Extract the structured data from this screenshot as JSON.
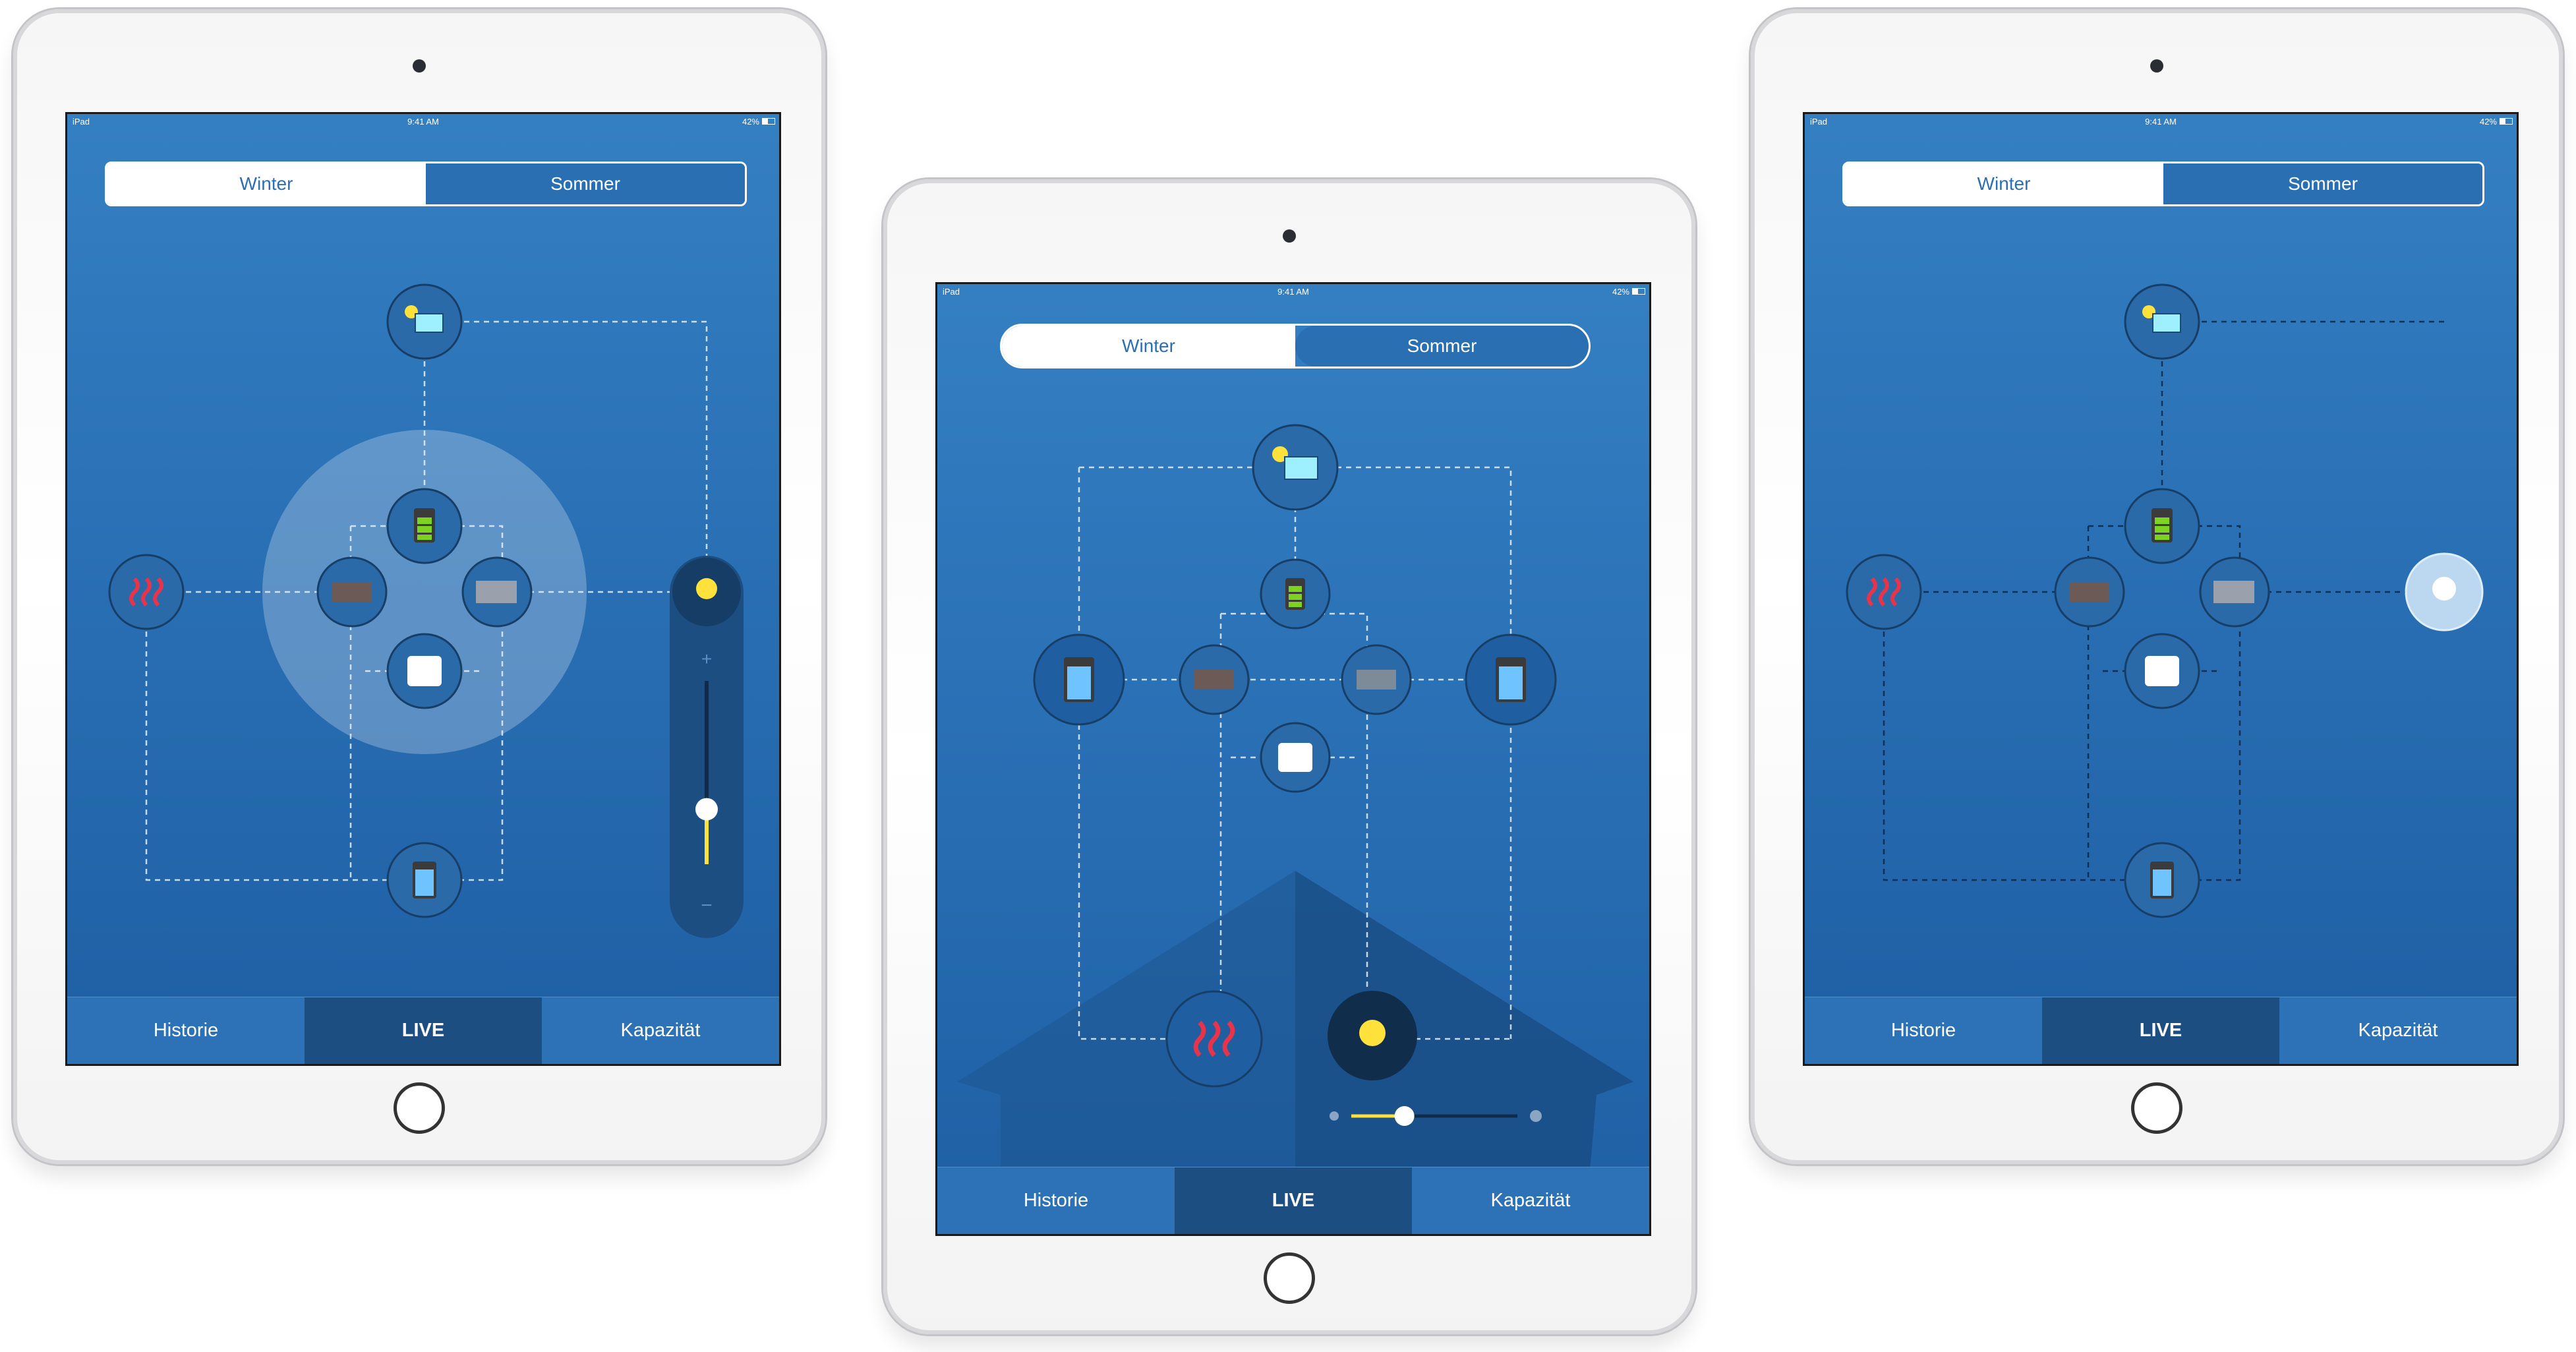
{
  "devices": [
    {
      "status": {
        "carrier": "iPad",
        "time": "9:41 AM",
        "battery": "42%"
      },
      "segment": {
        "winter": "Winter",
        "sommer": "Sommer",
        "selected": "winter"
      },
      "tabs": {
        "history": "Historie",
        "live": "LIVE",
        "capacity": "Kapazität",
        "active": "live"
      },
      "slider": {
        "plus": "+",
        "minus": "−",
        "level": 0.3
      }
    },
    {
      "status": {
        "carrier": "iPad",
        "time": "9:41 AM",
        "battery": "42%"
      },
      "segment": {
        "winter": "Winter",
        "sommer": "Sommer",
        "selected": "winter"
      },
      "tabs": {
        "history": "Historie",
        "live": "LIVE",
        "capacity": "Kapazität",
        "active": "live"
      },
      "slider": {
        "level": 0.32
      }
    },
    {
      "status": {
        "carrier": "iPad",
        "time": "9:41 AM",
        "battery": "42%"
      },
      "segment": {
        "winter": "Winter",
        "sommer": "Sommer",
        "selected": "winter"
      },
      "tabs": {
        "history": "Historie",
        "live": "LIVE",
        "capacity": "Kapazität",
        "active": "live"
      }
    }
  ],
  "colors": {
    "screen_blue": "#2b6fb3",
    "node_fill": "#2a6aa8",
    "node_dark": "#1c4a78",
    "battery_green": "#7ed321",
    "heat_red": "#e8344a",
    "light_yellow": "#ffe13c",
    "solar_cyan": "#9ef0ff"
  },
  "icons": [
    "solar-panel-icon",
    "battery-icon",
    "heater-icon",
    "radiator-icon",
    "storage-tank-icon",
    "water-boiler-icon",
    "light-bulb-icon",
    "heat-icon"
  ]
}
